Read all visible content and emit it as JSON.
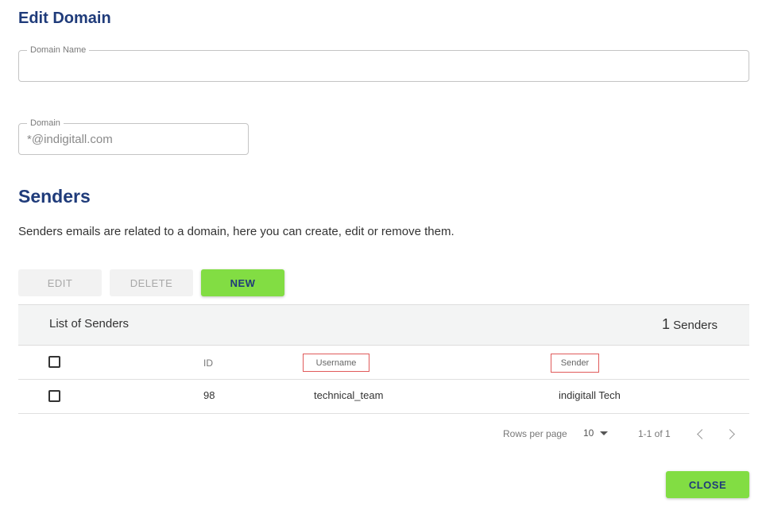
{
  "dialog": {
    "title": "Edit Domain",
    "domain_name_label": "Domain Name",
    "domain_name_value": "",
    "domain_label": "Domain",
    "domain_placeholder": "*@indigitall.com"
  },
  "senders": {
    "heading": "Senders",
    "description": "Senders emails are related to a domain, here you can create, edit or remove them.",
    "toolbar": {
      "edit_label": "EDIT",
      "delete_label": "DELETE",
      "new_label": "NEW"
    },
    "list_title": "List of Senders",
    "count_number": "1",
    "count_label": "Senders",
    "columns": {
      "id": "ID",
      "username": "Username",
      "sender": "Sender"
    },
    "rows": [
      {
        "id": "98",
        "username": "technical_team",
        "sender": "indigitall Tech"
      }
    ],
    "pagination": {
      "rows_per_page_label": "Rows per page",
      "rows_per_page_value": "10",
      "range": "1-1 of 1"
    }
  },
  "footer": {
    "close_label": "CLOSE"
  },
  "colors": {
    "title": "#1f3b7a",
    "accent_green": "#82dd43",
    "highlight_red": "#e05a5a"
  }
}
